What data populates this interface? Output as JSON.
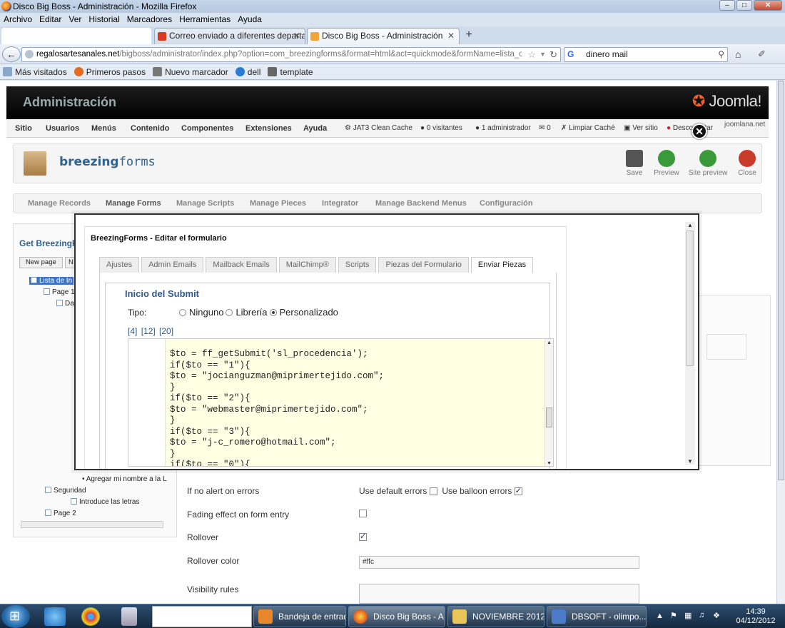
{
  "window": {
    "title": "Disco Big Boss - Administración - Mozilla Firefox"
  },
  "menubar": [
    "Archivo",
    "Editar",
    "Ver",
    "Historial",
    "Marcadores",
    "Herramientas",
    "Ayuda"
  ],
  "tabs": [
    {
      "label": "Correo enviado a diferentes departa...",
      "active": false
    },
    {
      "label": "Disco Big Boss - Administración",
      "active": true
    }
  ],
  "nav": {
    "url_host": "regalosartesanales.net",
    "url_path": "/bigboss/administrator/index.php?option=com_breezingforms&format=html&act=quickmode&formName=lista_de_invitados",
    "search_value": "dinero mail",
    "search_engine": "G"
  },
  "bookmarks": [
    "Más visitados",
    "Primeros pasos",
    "Nuevo marcador",
    "dell",
    "template"
  ],
  "joomla": {
    "header_title": "Administración",
    "logo": "Joomla!",
    "menu": [
      "Sitio",
      "Usuarios",
      "Menús",
      "Contenido",
      "Componentes",
      "Extensiones",
      "Ayuda"
    ],
    "status": [
      "JAT3 Clean Cache",
      "0 visitantes",
      "1 administrador",
      "0",
      "Limpiar Caché",
      "Ver sitio",
      "Desconectar",
      "joomlana.net"
    ],
    "component_name_bold": "breezing",
    "component_name_rest": "forms",
    "toolbar": [
      "Save",
      "Preview",
      "Site preview",
      "Close"
    ],
    "subnav": [
      "Manage Records",
      "Manage Forms",
      "Manage Scripts",
      "Manage Pieces",
      "Integrator",
      "Manage Backend Menus",
      "Configuración"
    ]
  },
  "left_panel": {
    "title": "Get BreezingF",
    "buttons": [
      "New page",
      "N"
    ],
    "tree": [
      "Lista de In",
      "Page 1",
      "Da",
      "Agregar mi nombre a la L",
      "Seguridad",
      "Introduce las letras",
      "Page 2"
    ]
  },
  "settings": {
    "no_alert_label": "If no alert on errors",
    "use_default_errors": "Use default errors",
    "use_balloon_errors": "Use balloon errors",
    "use_default_checked": false,
    "use_balloon_checked": true,
    "fading_label": "Fading effect on form entry",
    "fading_checked": false,
    "rollover_label": "Rollover",
    "rollover_checked": true,
    "rollover_color_label": "Rollover color",
    "rollover_color_value": "#ffc",
    "visibility_label": "Visibility rules"
  },
  "modal": {
    "title": "BreezingForms - Editar el formulario",
    "tabs": [
      "Ajustes",
      "Admin Emails",
      "Mailback Emails",
      "MailChimp®",
      "Scripts",
      "Piezas del Formulario",
      "Enviar Piezas"
    ],
    "active_tab": "Enviar Piezas",
    "section_title": "Inicio del Submit",
    "tipo_label": "Tipo:",
    "tipo_options": [
      "Ninguno",
      "Librería",
      "Personalizado"
    ],
    "tipo_selected": "Personalizado",
    "size_links": [
      "[4]",
      "[12]",
      "[20]"
    ],
    "code": "$to = ff_getSubmit('sl_procedencia');\nif($to == \"1\"){\n$to = \"jocianguzman@miprimertejido.com\";\n}\nif($to == \"2\"){\n$to = \"webmaster@miprimertejido.com\";\n}\nif($to == \"3\"){\n$to = \"j-c_romero@hotmail.com\";\n}\nif($to == \"0\"){"
  },
  "taskbar": {
    "windows": [
      "Bandeja de entrad...",
      "Disco Big Boss - A...",
      "NOVIEMBRE 2012",
      "DBSOFT - olimpo...."
    ],
    "time": "14:39",
    "date": "04/12/2012"
  },
  "colors": {
    "joomla_blue": "#1b7dd5",
    "editor_bg": "#ffffe4",
    "link_blue": "#2d5c8c"
  }
}
